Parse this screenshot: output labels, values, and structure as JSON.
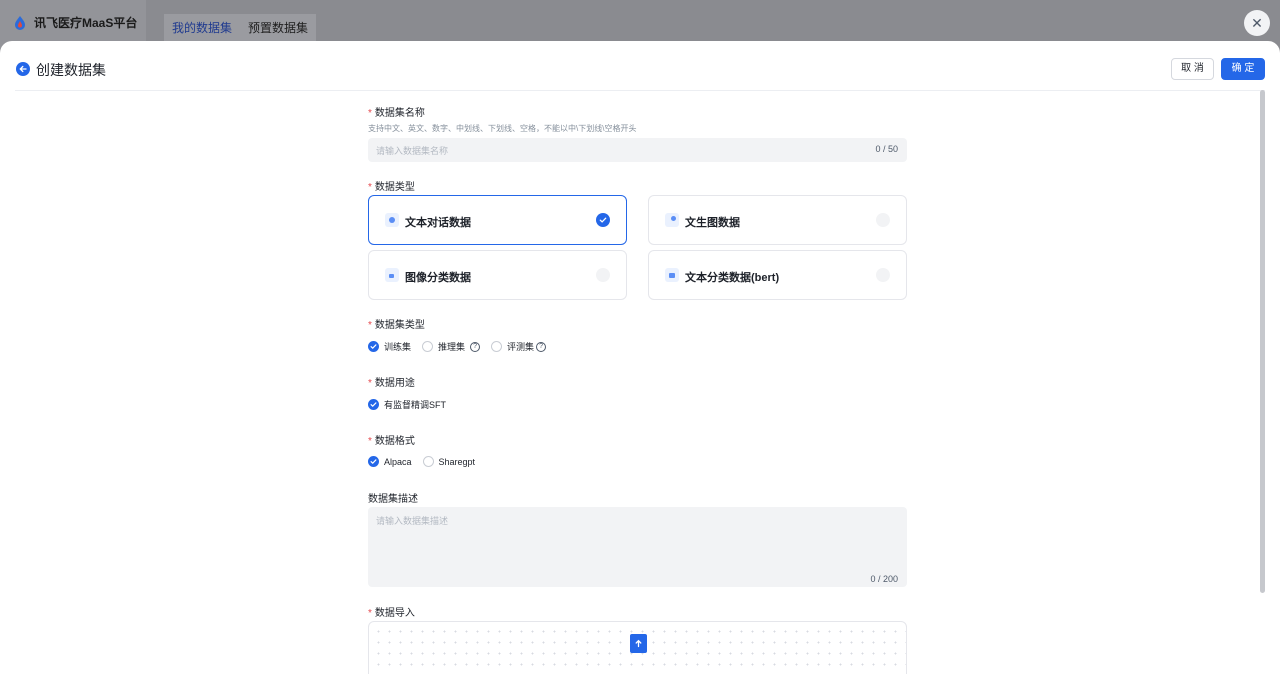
{
  "topbar": {
    "brand": "讯飞医疗MaaS平台",
    "tabs": [
      {
        "label": "我的数据集",
        "active": true
      },
      {
        "label": "预置数据集",
        "active": false
      }
    ]
  },
  "drawer": {
    "title": "创建数据集",
    "cancel_label": "取 消",
    "confirm_label": "确 定"
  },
  "form": {
    "name": {
      "label": "数据集名称",
      "hint": "支持中文、英文、数字、中划线、下划线、空格，不能以中\\下划线\\空格开头",
      "placeholder": "请输入数据集名称",
      "counter": "0 / 50"
    },
    "data_type": {
      "label": "数据类型",
      "options": [
        {
          "label": "文本对话数据",
          "icon": "chat-bubble-icon",
          "selected": true
        },
        {
          "label": "文生图数据",
          "icon": "text-to-image-icon",
          "selected": false
        },
        {
          "label": "图像分类数据",
          "icon": "image-icon",
          "selected": false
        },
        {
          "label": "文本分类数据(bert)",
          "icon": "text-classify-icon",
          "selected": false
        }
      ]
    },
    "dataset_kind": {
      "label": "数据集类型",
      "options": [
        {
          "label": "训练集",
          "selected": true
        },
        {
          "label": "推理集",
          "selected": false
        },
        {
          "label": "评测集",
          "selected": false
        }
      ]
    },
    "usage": {
      "label": "数据用途",
      "options": [
        {
          "label": "有监督精调SFT",
          "selected": true
        }
      ]
    },
    "format": {
      "label": "数据格式",
      "options": [
        {
          "label": "Alpaca",
          "selected": true
        },
        {
          "label": "Sharegpt",
          "selected": false
        }
      ]
    },
    "description": {
      "label": "数据集描述",
      "placeholder": "请输入数据集描述",
      "counter": "0 / 200"
    },
    "import": {
      "label": "数据导入"
    }
  },
  "colors": {
    "accent": "#2467e8",
    "required": "#e5484d",
    "overlay": "#8e8f94"
  }
}
